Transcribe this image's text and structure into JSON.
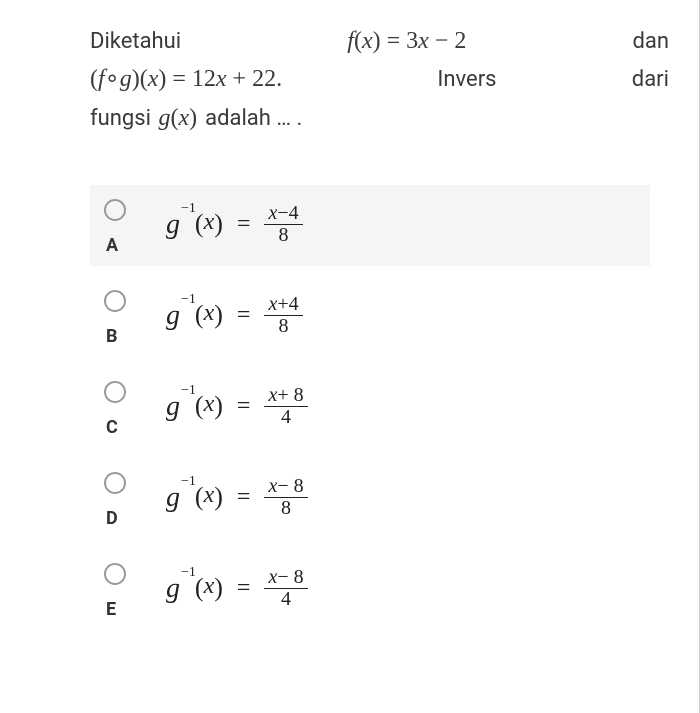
{
  "question": {
    "word_diketahui": "Diketahui",
    "f_expr_left": "f(x) = ",
    "f_expr_right": "3x − 2",
    "word_dan": "dan",
    "fog_left": "(f∘g)(x) = ",
    "fog_right": "12x + 22.",
    "word_invers": "Invers",
    "word_dari": "dari",
    "word_fungsi": "fungsi",
    "gx": "g(x)",
    "word_adalah": " adalah … ."
  },
  "inverse_label": "g⁻¹(x) =",
  "options": [
    {
      "letter": "A",
      "num": "x−4",
      "den": "8",
      "highlight": true
    },
    {
      "letter": "B",
      "num": "x+4",
      "den": "8",
      "highlight": false
    },
    {
      "letter": "C",
      "num": "x+ 8",
      "den": "4",
      "highlight": false
    },
    {
      "letter": "D",
      "num": "x− 8",
      "den": "8",
      "highlight": false
    },
    {
      "letter": "E",
      "num": "x− 8",
      "den": "4",
      "highlight": false
    }
  ]
}
